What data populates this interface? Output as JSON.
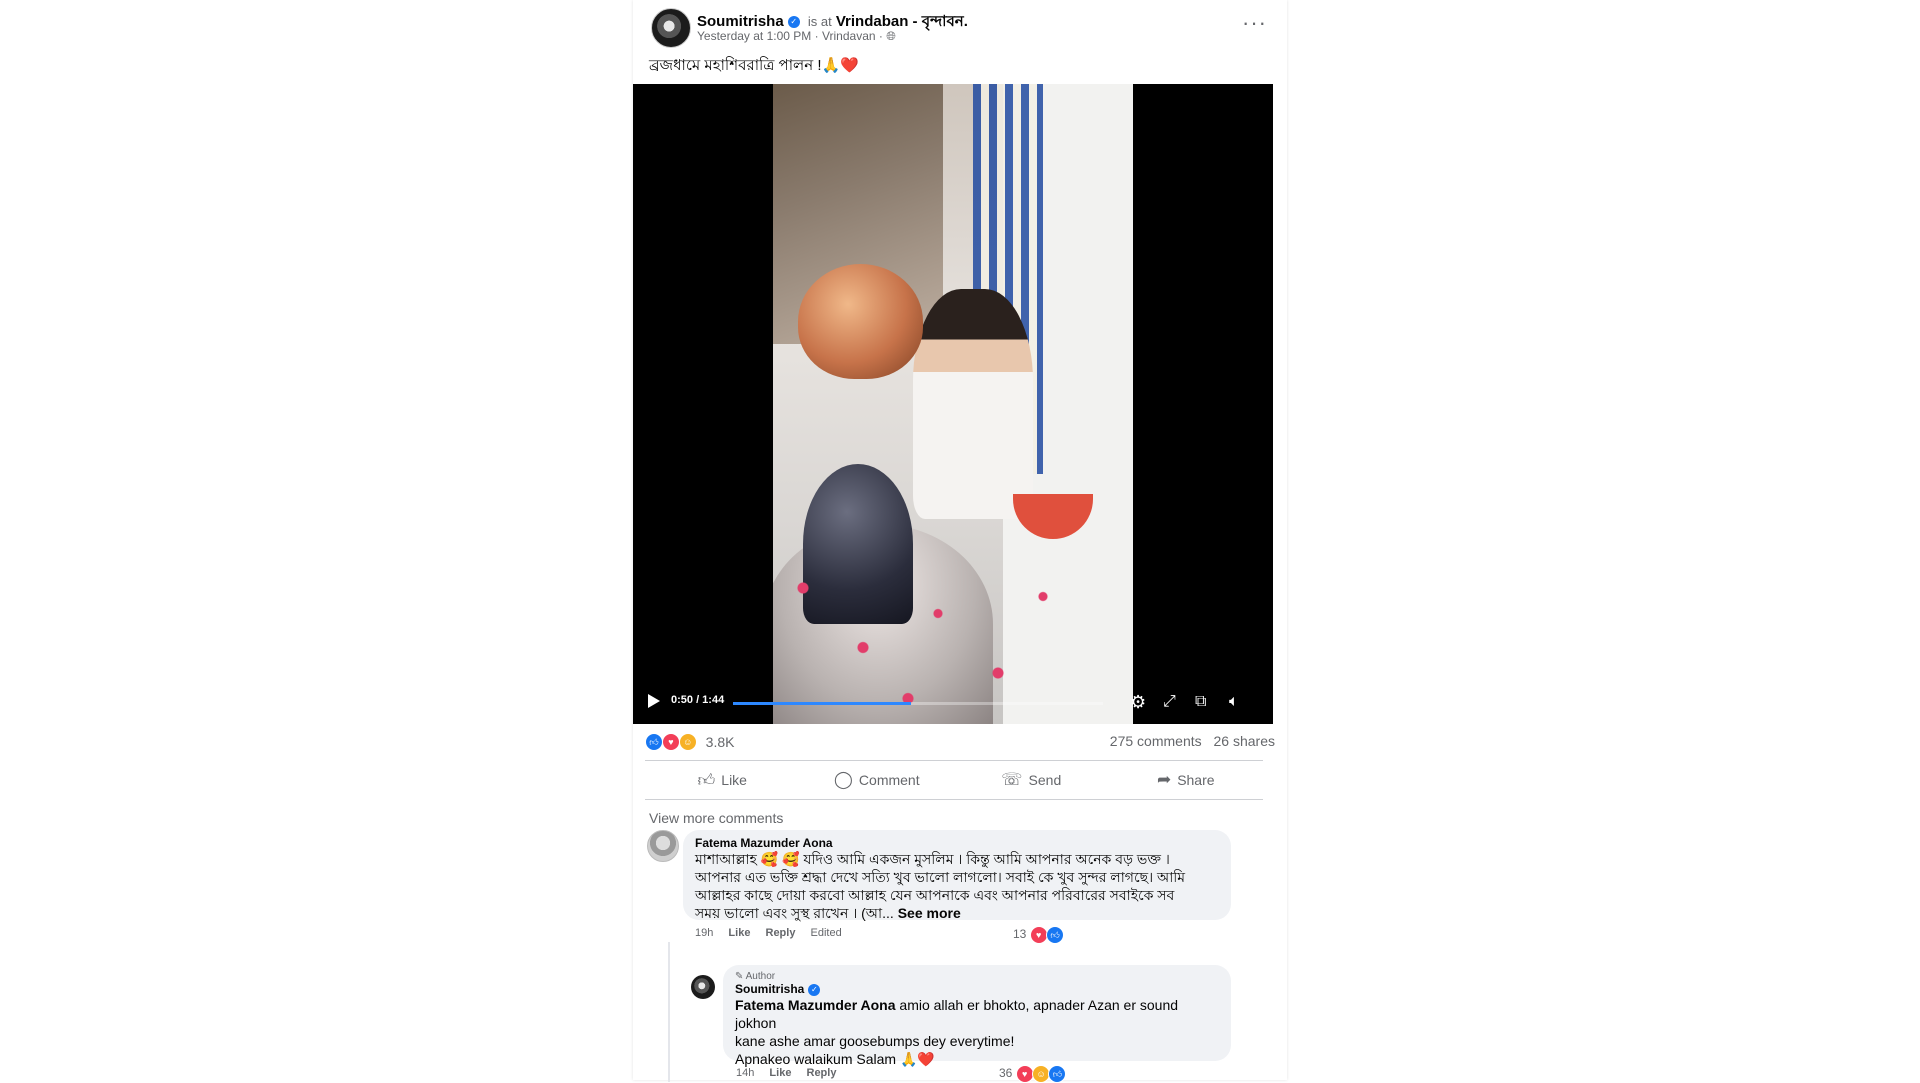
{
  "post": {
    "author": "Soumitrisha",
    "is_at": "is at",
    "location": "Vrindaban - বৃন্দাবন.",
    "meta": "Yesterday at 1:00 PM · Vrindavan ·",
    "privacy_icon": "globe-icon",
    "caption": "ব্রজধামে মহাশিবরাত্রি পালন !🙏❤️",
    "more_label": "···"
  },
  "video": {
    "current_time": "0:50",
    "duration": "1:44",
    "time_label": "0:50 / 1:44",
    "progress_fraction": 0.48,
    "icons": [
      "play-icon",
      "settings-icon",
      "fullscreen-icon",
      "pip-icon",
      "volume-icon"
    ]
  },
  "stats": {
    "reaction_count": "3.8K",
    "comments": "275 comments",
    "shares": "26 shares",
    "colors": {
      "like": "#1877f2",
      "love": "#f33e58",
      "care": "#f7b125"
    }
  },
  "actions": {
    "like": "Like",
    "comment": "Comment",
    "send": "Send",
    "share": "Share"
  },
  "view_more_comments": "View more comments",
  "comments": [
    {
      "name": "Fatema Mazumder Aona",
      "text_1": "মাশাআল্লাহ 🥰 🥰 যদিও আমি একজন মুসলিম । কিন্তু আমি আপনার অনেক বড় ভক্ত ।",
      "text_2": "আপনার এত ভক্তি শ্রদ্ধা দেখে সত্যি খুব ভালো লাগলো। সবাই কে খুব সুন্দর লাগছে। আমি",
      "text_3": "আল্লাহর কাছে দোয়া করবো আল্লাহ যেন আপনাকে এবং আপনার পরিবারের সবাইকে সব",
      "text_4": "সময় ভালো এবং সুস্থ রাখেন । (আ...",
      "see_more": "See more",
      "time": "19h",
      "like": "Like",
      "reply": "Reply",
      "edited": "Edited",
      "reaction_count": "13"
    },
    {
      "author_tag": "Author",
      "name": "Soumitrisha",
      "mention": "Fatema Mazumder Aona",
      "text_1": " amio allah er bhokto, apnader Azan er sound jokhon",
      "text_2": "kane ashe amar goosebumps dey everytime!",
      "text_3": "Apnakeo walaikum Salam 🙏❤️",
      "time": "14h",
      "like": "Like",
      "reply": "Reply",
      "reaction_count": "36"
    }
  ]
}
